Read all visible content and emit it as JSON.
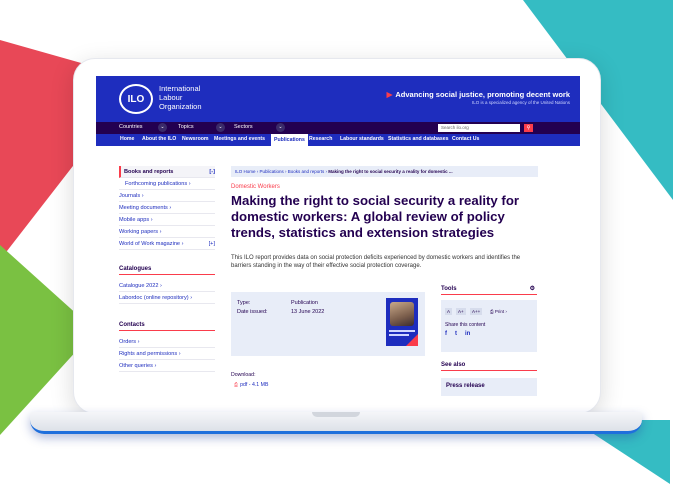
{
  "header": {
    "logo_text": "ILO",
    "org_line1": "International",
    "org_line2": "Labour",
    "org_line3": "Organization",
    "slogan": "Advancing social justice, promoting decent work",
    "sub_slogan": "ILO is a specialized agency of the United Nations"
  },
  "nav_top": {
    "countries": "Countries",
    "topics": "Topics",
    "sectors": "Sectors",
    "search_placeholder": "Search ilo.org"
  },
  "nav_main": [
    "Home",
    "About the ILO",
    "Newsroom",
    "Meetings and events",
    "Publications",
    "Research",
    "Labour standards",
    "Statistics and databases",
    "Contact Us"
  ],
  "sidebar": {
    "items": [
      {
        "label": "Books and reports"
      },
      {
        "label": "Forthcoming publications ›"
      },
      {
        "label": "Journals ›"
      },
      {
        "label": "Meeting documents ›"
      },
      {
        "label": "Mobile apps ›"
      },
      {
        "label": "Working papers ›"
      },
      {
        "label": "World of Work magazine ›"
      }
    ],
    "catalogues_heading": "Catalogues",
    "catalogues": [
      "Catalogue 2022 ›",
      "Labordoc (online repository) ›"
    ],
    "contacts_heading": "Contacts",
    "contacts": [
      "Orders ›",
      "Rights and permissions ›",
      "Other queries ›"
    ]
  },
  "breadcrumb": {
    "trail": "ILO Home › Publications › Books and reports › ",
    "current": "Making the right to social security a reality for domestic ..."
  },
  "article": {
    "category": "Domestic Workers",
    "title": "Making the right to social security a reality for domestic workers: A global review of policy trends, statistics and extension strategies",
    "description": "This ILO report provides data on social protection deficits experienced by domestic workers and identifies the barriers standing in the way of their effective social protection coverage.",
    "type_label": "Type:",
    "type_value": "Publication",
    "date_label": "Date issued:",
    "date_value": "13 June 2022",
    "download_label": "Download:",
    "download_link": "pdf - 4.1 MB"
  },
  "tools": {
    "heading": "Tools",
    "font_buttons": [
      "A",
      "A+",
      "A++"
    ],
    "print": "Print",
    "share": "Share this content",
    "social": [
      "f",
      "t",
      "in"
    ]
  },
  "see_also": {
    "heading": "See also",
    "press": "Press release"
  },
  "colors": {
    "ilo_blue": "#1e2dbe",
    "ilo_dark": "#230050",
    "ilo_red": "#fa3c4b",
    "deco_red": "#e84857",
    "deco_teal": "#35bcc3",
    "deco_green": "#7ac142"
  }
}
